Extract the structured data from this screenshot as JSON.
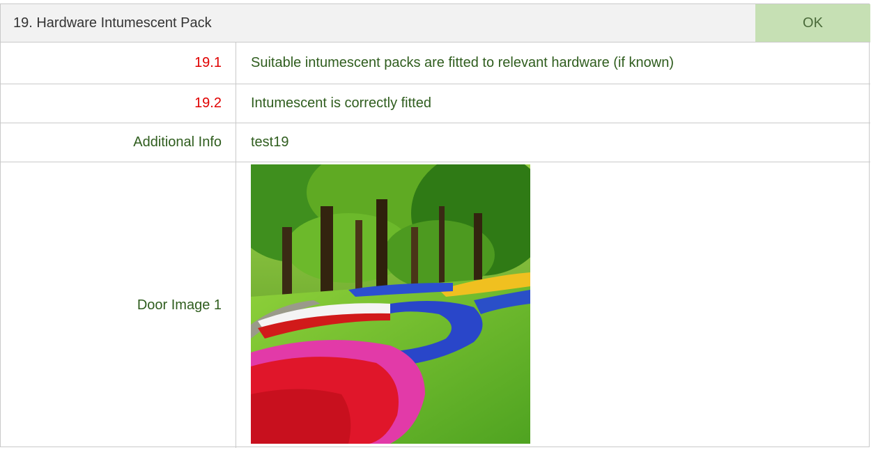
{
  "section": {
    "title": "19. Hardware Intumescent Pack",
    "status": "OK",
    "status_color": "#c6e0b4"
  },
  "rows": [
    {
      "number": "19.1",
      "text": "Suitable intumescent packs are fitted to relevant hardware (if known)"
    },
    {
      "number": "19.2",
      "text": "Intumescent is correctly fitted"
    }
  ],
  "additional_info": {
    "label": "Additional Info",
    "value": "test19"
  },
  "door_image": {
    "label": "Door Image 1",
    "alt": "door-photo"
  },
  "colors": {
    "number_red": "#e00000",
    "label_green": "#2f5d1e"
  }
}
